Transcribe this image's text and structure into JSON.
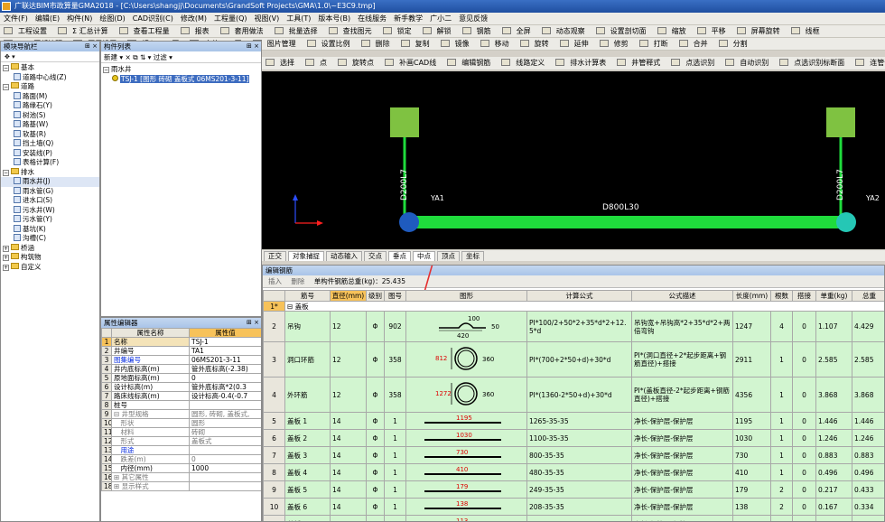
{
  "title": "广联达BIM市政算量GMA2018 - [C:\\Users\\shangjj\\Documents\\GrandSoft Projects\\GMA\\1.0\\~E3C9.tmp]",
  "menu": [
    "文件(F)",
    "编辑(E)",
    "构件(N)",
    "绘图(D)",
    "CAD识别(C)",
    "修改(M)",
    "工程量(Q)",
    "视图(V)",
    "工具(T)",
    "版本号(B)",
    "在线服务",
    "新手教学",
    "广小二",
    "意见反馈"
  ],
  "toolbar1": [
    "工程设置",
    "Σ 汇总计算",
    "查看工程量",
    "报表",
    "套用做法",
    "批量选择",
    "查找图元",
    "锁定",
    "解锁",
    "钢筋",
    "全屏",
    "动态观察",
    "设置剖切面",
    "缩放",
    "平移",
    "屏幕旋转",
    "线框"
  ],
  "toolbar2_left": [
    "新建",
    "×",
    "过滤"
  ],
  "toolbar2": [
    "CAD图纸管理",
    "图层设置",
    "插入CAD图",
    "定位CAD图",
    "图片管理",
    "设置比例",
    "删除",
    "复制",
    "镜像",
    "移动",
    "旋转",
    "延伸",
    "修剪",
    "打断",
    "合并",
    "分割"
  ],
  "toolbar3": [
    "选择",
    "点",
    "旋转点",
    "补画CAD线",
    "编辑钢筋",
    "线路定义",
    "排水计算表",
    "井管释式",
    "点选识别",
    "自动识别",
    "点选识别标断面",
    "连管设置",
    "原图校对"
  ],
  "nav": {
    "title": "模块导航栏",
    "items": [
      {
        "label": "基本",
        "level": 0,
        "kind": "folder",
        "sign": "−"
      },
      {
        "label": "道路中心线(Z)",
        "level": 1,
        "kind": "item"
      },
      {
        "label": "道路",
        "level": 0,
        "kind": "folder",
        "sign": "−"
      },
      {
        "label": "路面(M)",
        "level": 1,
        "kind": "item"
      },
      {
        "label": "路缘石(Y)",
        "level": 1,
        "kind": "item"
      },
      {
        "label": "树池(S)",
        "level": 1,
        "kind": "item"
      },
      {
        "label": "路基(W)",
        "level": 1,
        "kind": "item"
      },
      {
        "label": "软基(R)",
        "level": 1,
        "kind": "item"
      },
      {
        "label": "挡土墙(Q)",
        "level": 1,
        "kind": "item"
      },
      {
        "label": "安装线(P)",
        "level": 1,
        "kind": "item"
      },
      {
        "label": "表格计算(F)",
        "level": 1,
        "kind": "item"
      },
      {
        "label": "排水",
        "level": 0,
        "kind": "folder",
        "sign": "−"
      },
      {
        "label": "雨水井(J)",
        "level": 1,
        "kind": "item"
      },
      {
        "label": "雨水管(G)",
        "level": 1,
        "kind": "item"
      },
      {
        "label": "进水口(S)",
        "level": 1,
        "kind": "item"
      },
      {
        "label": "污水井(W)",
        "level": 1,
        "kind": "item"
      },
      {
        "label": "污水管(Y)",
        "level": 1,
        "kind": "item"
      },
      {
        "label": "基坑(K)",
        "level": 1,
        "kind": "item"
      },
      {
        "label": "沟槽(C)",
        "level": 1,
        "kind": "item"
      },
      {
        "label": "桥涵",
        "level": 0,
        "kind": "folder",
        "sign": "+"
      },
      {
        "label": "构筑物",
        "level": 0,
        "kind": "folder",
        "sign": "+"
      },
      {
        "label": "自定义",
        "level": 0,
        "kind": "folder",
        "sign": "+"
      }
    ]
  },
  "component_list": {
    "title": "构件列表",
    "root": "雨水井",
    "selected": "TSJ-1 [图形 砖砌 盖板式 06MS201-3-11]"
  },
  "properties": {
    "title": "属性编辑器",
    "col_name": "属性名称",
    "col_value": "属性值",
    "rows": [
      {
        "n": "1",
        "name": "名称",
        "value": "TSJ-1",
        "style": "sel"
      },
      {
        "n": "2",
        "name": "井编号",
        "value": "TA1",
        "style": ""
      },
      {
        "n": "3",
        "name": "图集编号",
        "value": "06MS201-3-11",
        "style": "blue"
      },
      {
        "n": "4",
        "name": "井内底标高(m)",
        "value": "管外底标高(-2.38)",
        "style": ""
      },
      {
        "n": "5",
        "name": "原地面标高(m)",
        "value": "0",
        "style": ""
      },
      {
        "n": "6",
        "name": "设计标高(m)",
        "value": "管外底标高*2(0.3",
        "style": ""
      },
      {
        "n": "7",
        "name": "路床线标高(m)",
        "value": "设计标高-0.4(-0.7",
        "style": ""
      },
      {
        "n": "8",
        "name": "桩号",
        "value": "",
        "style": ""
      },
      {
        "n": "9",
        "name": "⊟ 井型规格",
        "value": "圆形, 砖砌, 盖板式,",
        "style": "gray"
      },
      {
        "n": "10",
        "name": "　形状",
        "value": "圆形",
        "style": "gray"
      },
      {
        "n": "11",
        "name": "　材料",
        "value": "砖砌",
        "style": "gray"
      },
      {
        "n": "12",
        "name": "　形式",
        "value": "盖板式",
        "style": "gray"
      },
      {
        "n": "13",
        "name": "　用途",
        "value": "",
        "style": "blue"
      },
      {
        "n": "14",
        "name": "　跌差(m)",
        "value": "0",
        "style": "gray"
      },
      {
        "n": "15",
        "name": "　内径(mm)",
        "value": "1000",
        "style": ""
      },
      {
        "n": "16",
        "name": "⊞ 其它属性",
        "value": "",
        "style": "gray"
      },
      {
        "n": "18",
        "name": "⊞ 显示样式",
        "value": "",
        "style": "gray"
      }
    ]
  },
  "cad": {
    "label_v1": "D200L7",
    "label_v2": "D200L7",
    "label_h": "D800L30",
    "label_ya1": "YA1",
    "label_ya2": "YA2"
  },
  "statusbar": [
    "正交",
    "对象捕捉",
    "动态输入",
    "交点",
    "垂点",
    "中点",
    "顶点",
    "坐标"
  ],
  "rebar": {
    "title": "编辑钢筋",
    "insert": "插入",
    "delete": "删除",
    "total_label": "单构件钢筋总重(kg)：25.435",
    "headers": [
      "筋号",
      "直径(mm)",
      "级别",
      "图号",
      "图形",
      "计算公式",
      "公式描述",
      "长度(mm)",
      "根数",
      "搭接",
      "单重(kg)",
      "总重"
    ],
    "group": "盖板",
    "rows": [
      {
        "n": "2",
        "name": "吊钩",
        "dia": "12",
        "lv": "Φ",
        "fig": "902",
        "shape": "hook",
        "s1": "100",
        "s2": "50",
        "s3": "420",
        "formula": "PI*100/2+50*2+35*d*2+12.5*d",
        "desc": "吊钩宽+吊钩高*2+35*d*2+两倍弯钩",
        "len": "1247",
        "cnt": "4",
        "lap": "0",
        "unit": "1.107",
        "total": "4.429"
      },
      {
        "n": "3",
        "name": "洞口环筋",
        "dia": "12",
        "lv": "Φ",
        "fig": "358",
        "shape": "ring",
        "s1": "812",
        "s2": "360",
        "formula": "PI*(700+2*50+d)+30*d",
        "desc": "PI*(洞口直径+2*起步距离+钢筋直径)+搭接",
        "len": "2911",
        "cnt": "1",
        "lap": "0",
        "unit": "2.585",
        "total": "2.585"
      },
      {
        "n": "4",
        "name": "外环筋",
        "dia": "12",
        "lv": "Φ",
        "fig": "358",
        "shape": "ring",
        "s1": "1272",
        "s2": "360",
        "formula": "PI*(1360-2*50+d)+30*d",
        "desc": "PI*(盖板直径-2*起步距离+钢筋直径)+搭接",
        "len": "4356",
        "cnt": "1",
        "lap": "0",
        "unit": "3.868",
        "total": "3.868"
      },
      {
        "n": "5",
        "name": "盖板 1",
        "dia": "14",
        "lv": "Φ",
        "fig": "1",
        "shape": "bar",
        "s1": "1195",
        "formula": "1265-35-35",
        "desc": "净长-保护层-保护层",
        "len": "1195",
        "cnt": "1",
        "lap": "0",
        "unit": "1.446",
        "total": "1.446"
      },
      {
        "n": "6",
        "name": "盖板 2",
        "dia": "14",
        "lv": "Φ",
        "fig": "1",
        "shape": "bar",
        "s1": "1030",
        "formula": "1100-35-35",
        "desc": "净长-保护层-保护层",
        "len": "1030",
        "cnt": "1",
        "lap": "0",
        "unit": "1.246",
        "total": "1.246"
      },
      {
        "n": "7",
        "name": "盖板 3",
        "dia": "14",
        "lv": "Φ",
        "fig": "1",
        "shape": "bar",
        "s1": "730",
        "formula": "800-35-35",
        "desc": "净长-保护层-保护层",
        "len": "730",
        "cnt": "1",
        "lap": "0",
        "unit": "0.883",
        "total": "0.883"
      },
      {
        "n": "8",
        "name": "盖板 4",
        "dia": "14",
        "lv": "Φ",
        "fig": "1",
        "shape": "bar",
        "s1": "410",
        "formula": "480-35-35",
        "desc": "净长-保护层-保护层",
        "len": "410",
        "cnt": "1",
        "lap": "0",
        "unit": "0.496",
        "total": "0.496"
      },
      {
        "n": "9",
        "name": "盖板 5",
        "dia": "14",
        "lv": "Φ",
        "fig": "1",
        "shape": "bar",
        "s1": "179",
        "formula": "249-35-35",
        "desc": "净长-保护层-保护层",
        "len": "179",
        "cnt": "2",
        "lap": "0",
        "unit": "0.217",
        "total": "0.433"
      },
      {
        "n": "10",
        "name": "盖板 6",
        "dia": "14",
        "lv": "Φ",
        "fig": "1",
        "shape": "bar",
        "s1": "138",
        "formula": "208-35-35",
        "desc": "净长-保护层-保护层",
        "len": "138",
        "cnt": "2",
        "lap": "0",
        "unit": "0.167",
        "total": "0.334"
      },
      {
        "n": "11",
        "name": "盖板 7",
        "dia": "14",
        "lv": "Φ",
        "fig": "1",
        "shape": "bar",
        "s1": "113",
        "formula": "183-35-35",
        "desc": "净长-保护层-保护层",
        "len": "113",
        "cnt": "2",
        "lap": "0",
        "unit": "0.137",
        "total": "0.273"
      }
    ]
  }
}
